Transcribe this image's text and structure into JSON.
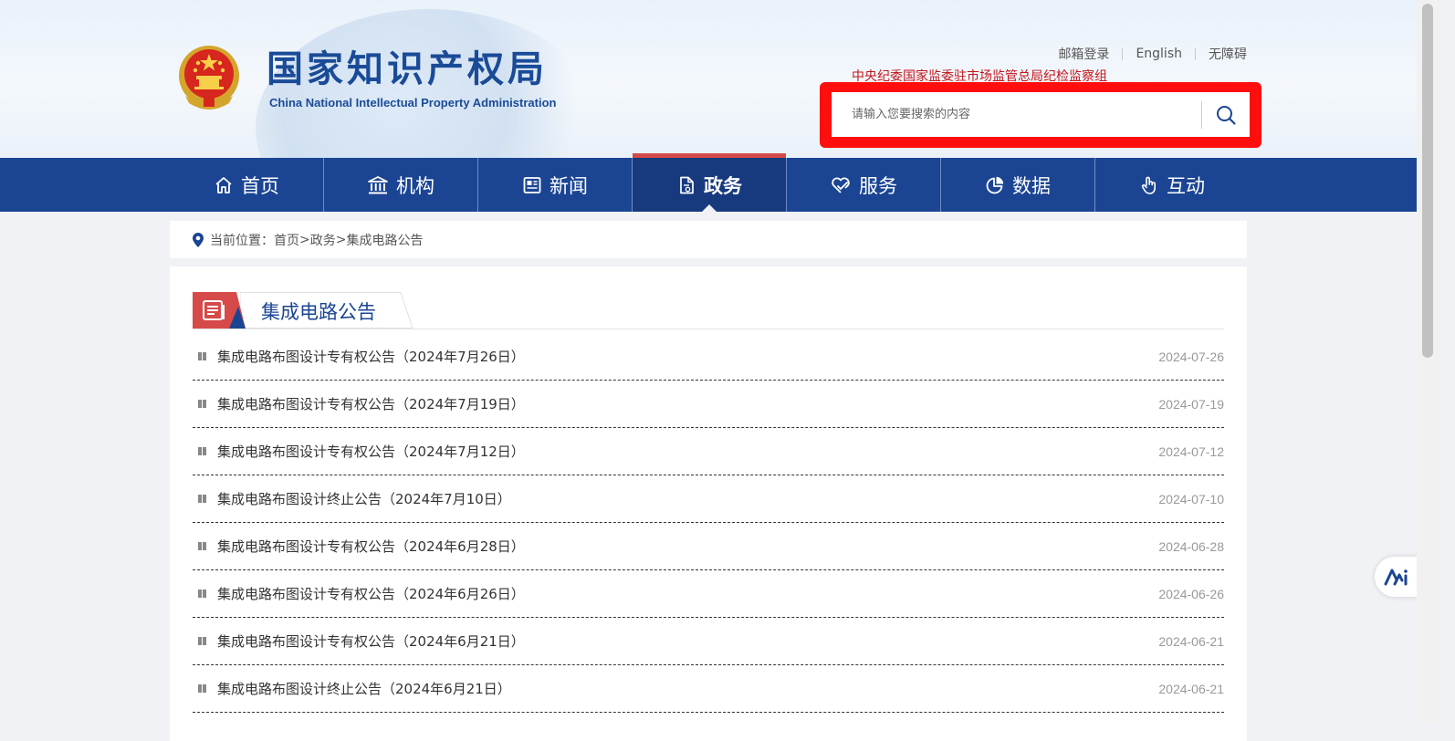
{
  "header": {
    "logo_cn": "国家知识产权局",
    "logo_en": "China National Intellectual Property Administration",
    "top_links": [
      "邮箱登录",
      "English",
      "无障碍"
    ],
    "agency_line": "中央纪委国家监委驻市场监管总局纪检监察组",
    "search": {
      "placeholder": "请输入您要搜索的内容",
      "value": ""
    }
  },
  "nav": {
    "items": [
      {
        "label": "首页",
        "icon": "home-icon"
      },
      {
        "label": "机构",
        "icon": "institution-icon"
      },
      {
        "label": "新闻",
        "icon": "news-icon"
      },
      {
        "label": "政务",
        "icon": "document-icon",
        "active": true
      },
      {
        "label": "服务",
        "icon": "heart-hand-icon"
      },
      {
        "label": "数据",
        "icon": "pie-chart-icon"
      },
      {
        "label": "互动",
        "icon": "hand-pointer-icon"
      }
    ]
  },
  "breadcrumb": {
    "prefix": "当前位置：",
    "items": [
      "首页",
      "政务",
      "集成电路公告"
    ],
    "separator": ">"
  },
  "section": {
    "title": "集成电路公告",
    "items": [
      {
        "title": "集成电路布图设计专有权公告（2024年7月26日）",
        "date": "2024-07-26"
      },
      {
        "title": "集成电路布图设计专有权公告（2024年7月19日）",
        "date": "2024-07-19"
      },
      {
        "title": "集成电路布图设计专有权公告（2024年7月12日）",
        "date": "2024-07-12"
      },
      {
        "title": "集成电路布图设计终止公告（2024年7月10日）",
        "date": "2024-07-10"
      },
      {
        "title": "集成电路布图设计专有权公告（2024年6月28日）",
        "date": "2024-06-28"
      },
      {
        "title": "集成电路布图设计专有权公告（2024年6月26日）",
        "date": "2024-06-26"
      },
      {
        "title": "集成电路布图设计专有权公告（2024年6月21日）",
        "date": "2024-06-21"
      },
      {
        "title": "集成电路布图设计终止公告（2024年6月21日）",
        "date": "2024-06-21"
      }
    ]
  },
  "colors": {
    "nav_bg": "#1b4593",
    "nav_active": "#173a7e",
    "accent_red": "#c0141a",
    "highlight_frame": "#ff0e0e"
  }
}
